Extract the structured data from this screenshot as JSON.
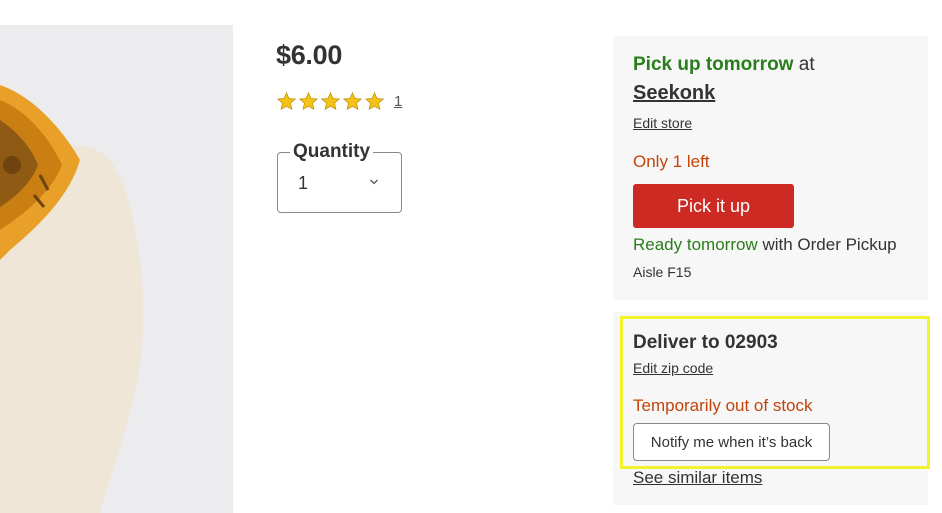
{
  "product": {
    "price": "$6.00",
    "rating": {
      "stars": 5,
      "count": "1"
    },
    "quantity": {
      "label": "Quantity",
      "value": "1"
    }
  },
  "pickup": {
    "headline_green": "Pick up tomorrow",
    "headline_rest": " at",
    "store_name": "Seekonk",
    "edit_store": "Edit store",
    "stock_note": "Only 1 left",
    "button_label": "Pick it up",
    "ready_green": "Ready tomorrow",
    "ready_rest": " with Order Pickup",
    "aisle": "Aisle F15"
  },
  "delivery": {
    "title": "Deliver to 02903",
    "edit_zip": "Edit zip code",
    "status": "Temporarily out of stock",
    "notify_button": "Notify me when it’s back",
    "similar_link": "See similar items"
  },
  "colors": {
    "green": "#2a7d1c",
    "orange_text": "#c2440b",
    "primary_red": "#cc2a22",
    "highlight": "#f3f32a",
    "star": "#f5c218"
  },
  "icons": {
    "star": "star-icon",
    "chevron": "chevron-down-icon"
  }
}
